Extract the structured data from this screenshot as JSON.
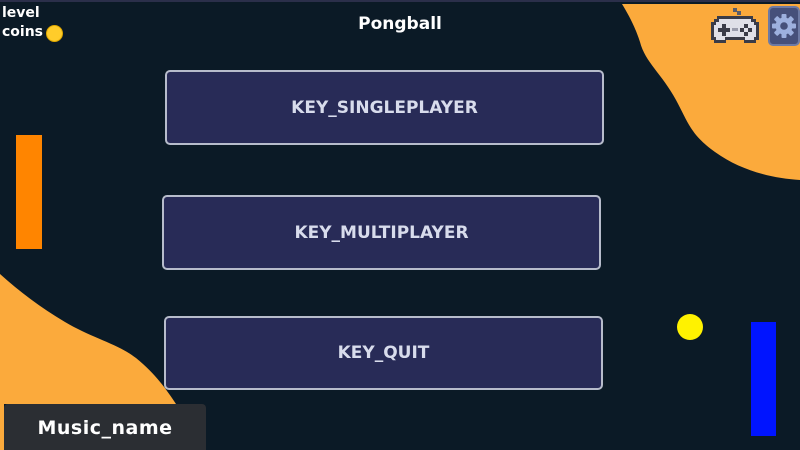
{
  "hud": {
    "level_label": "level",
    "coins_label": "coins",
    "coin_icon": "coin-icon"
  },
  "title": "Pongball",
  "menu": {
    "singleplayer": "KEY_SINGLEPLAYER",
    "multiplayer": "KEY_MULTIPLAYER",
    "quit": "KEY_QUIT"
  },
  "music": {
    "name": "Music_name"
  },
  "icons": {
    "controller": "gamepad-icon",
    "settings": "gear-icon"
  },
  "colors": {
    "background": "#0b1a26",
    "blob": "#fbaa3c",
    "button_fill": "#282b57",
    "button_border": "#b7bccb",
    "paddle_left": "#ff8500",
    "paddle_right": "#0014ff",
    "ball": "#fff200",
    "coin": "#ffcc2a"
  }
}
